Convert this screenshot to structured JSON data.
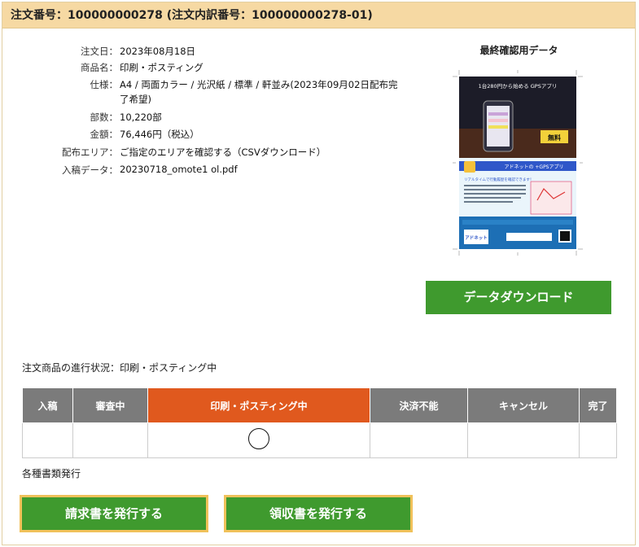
{
  "header": {
    "title": "注文番号：100000000278 (注文内訳番号：100000000278-01)"
  },
  "order": {
    "rows": [
      {
        "label": "注文日：",
        "value": "2023年08月18日"
      },
      {
        "label": "商品名：",
        "value": "印刷・ポスティング"
      },
      {
        "label": "仕様：",
        "value": "A4 / 両面カラー / 光沢紙 / 標準 / 軒並み(2023年09月02日配布完",
        "value2": "了希望)"
      },
      {
        "label": "部数：",
        "value": "10,220部"
      },
      {
        "label": "金額：",
        "value": "76,446円（税込）"
      },
      {
        "label": "配布エリア：",
        "value": "ご指定のエリアを確認する（CSVダウンロード）"
      },
      {
        "label": "入稿データ：",
        "value": "20230718_omote1 ol.pdf"
      }
    ]
  },
  "preview": {
    "title": "最終確認用データ",
    "flyer": {
      "headline": "1台280円から始める GPSアプリ",
      "badge": "無料",
      "band_title": "アドネットの +GPSアプリ",
      "sub_title": "リアルタイムで行動履歴を確認できます！",
      "brand": "アドネット"
    }
  },
  "download_button": "データダウンロード",
  "progress": {
    "status_text": "注文商品の進行状況：印刷・ポスティング中",
    "columns": [
      "入稿",
      "審査中",
      "印刷・ポスティング中",
      "決済不能",
      "キャンセル",
      "完了"
    ],
    "active_index": 2
  },
  "documents": {
    "label": "各種書類発行",
    "invoice_button": "請求書を発行する",
    "receipt_button": "領収書を発行する"
  },
  "colors": {
    "header_bg": "#f6d9a3",
    "green": "#3f9a2e",
    "active_orange": "#e0591e",
    "gray_header": "#7b7b7b",
    "link": "#2b62b2"
  }
}
